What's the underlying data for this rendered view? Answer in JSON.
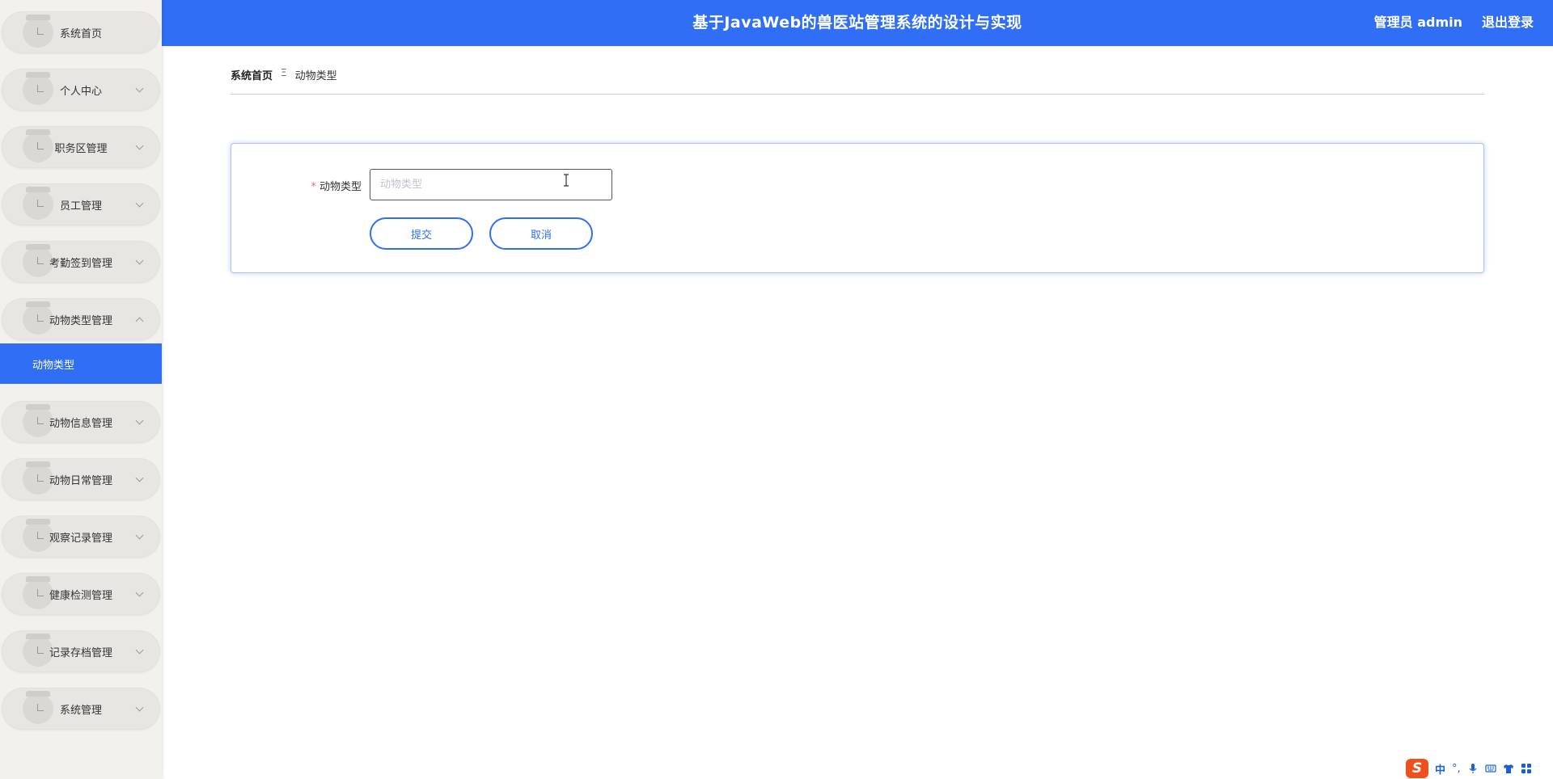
{
  "header": {
    "title": "基于JavaWeb的兽医站管理系统的设计与实现",
    "user": "管理员 admin",
    "logout": "退出登录"
  },
  "sidebar": {
    "items": [
      {
        "label": "系统首页",
        "has_arrow": false
      },
      {
        "label": "个人中心",
        "has_arrow": true
      },
      {
        "label": "职务区管理",
        "has_arrow": true
      },
      {
        "label": "员工管理",
        "has_arrow": true
      },
      {
        "label": "考勤签到管理",
        "has_arrow": true
      },
      {
        "label": "动物类型管理",
        "has_arrow": true,
        "expanded": true
      },
      {
        "label": "动物信息管理",
        "has_arrow": true
      },
      {
        "label": "动物日常管理",
        "has_arrow": true
      },
      {
        "label": "观察记录管理",
        "has_arrow": true
      },
      {
        "label": "健康检测管理",
        "has_arrow": true
      },
      {
        "label": "记录存档管理",
        "has_arrow": true
      },
      {
        "label": "系统管理",
        "has_arrow": true
      }
    ],
    "active_submenu": "动物类型"
  },
  "breadcrumb": {
    "home": "系统首页",
    "separator": "Ξ",
    "current": "动物类型"
  },
  "form": {
    "required_mark": "*",
    "field_label": "动物类型",
    "field_value": "",
    "field_placeholder": "动物类型",
    "submit_label": "提交",
    "cancel_label": "取消"
  },
  "ime": {
    "logo": "S",
    "lang": "中",
    "punct": "°,"
  },
  "colors": {
    "primary": "#2f6ef5",
    "sidebar_bg": "#f2f1ee",
    "required": "#f56c6c",
    "ime_logo": "#f0501e"
  },
  "icons": {
    "menu_icon": "folder-circle-icon",
    "expand": "chevron-down-icon",
    "collapse": "chevron-up-icon",
    "breadcrumb_sep": "menu-lines-icon",
    "ime_mic": "microphone-icon",
    "ime_keyboard": "keyboard-icon",
    "ime_skin": "shirt-icon",
    "ime_tools": "grid-icon"
  }
}
